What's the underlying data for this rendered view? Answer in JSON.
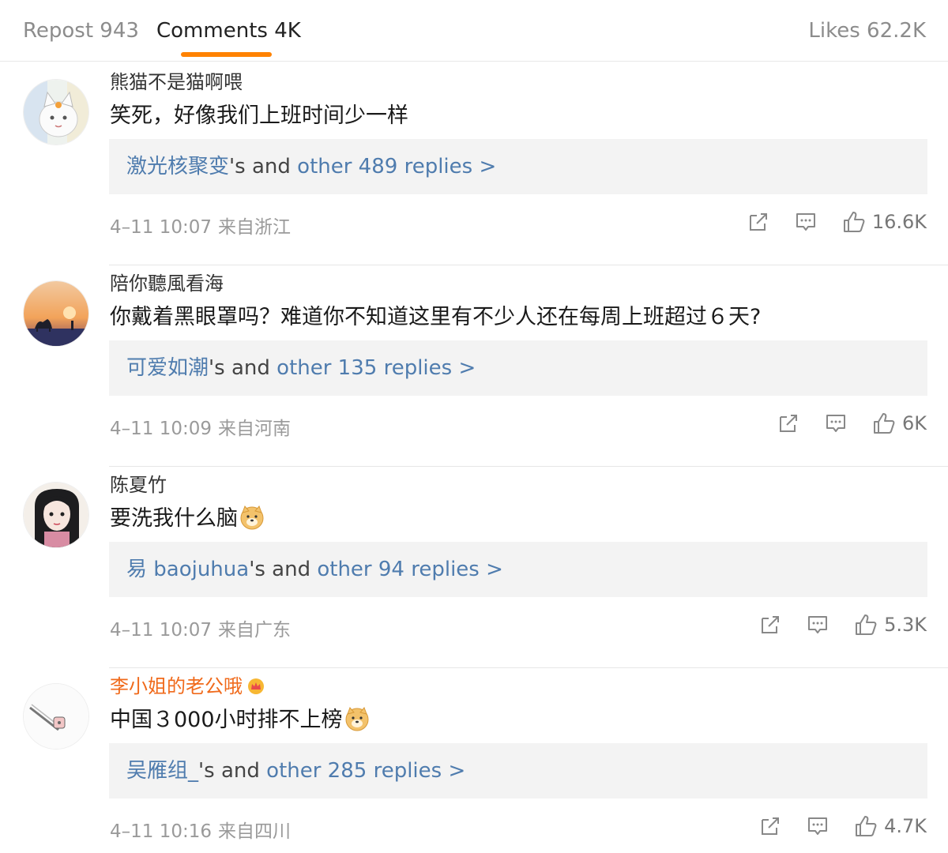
{
  "tabs": {
    "repost": "Repost 943",
    "comments": "Comments 4K",
    "likes": "Likes 62.2K",
    "active_color": "#ff8200"
  },
  "reply_mid_text": "'s and ",
  "comments": [
    {
      "username": "熊猫不是猫啊喂",
      "text": "笑死，好像我们上班时间少一样",
      "reply_user": "激光核聚变",
      "reply_count": "other 489 replies >",
      "date": "4–11 10:07",
      "location": "来自浙江",
      "likes": "16.6K"
    },
    {
      "username": "陪你聽風看海",
      "text": "你戴着黑眼罩吗？难道你不知道这里有不少人还在每周上班超过６天?",
      "reply_user": "可爱如潮",
      "reply_count": "other 135 replies >",
      "date": "4–11 10:09",
      "location": "来自河南",
      "likes": "6K"
    },
    {
      "username": "陈夏竹",
      "text": "要洗我什么脑",
      "emoji": "doge-emoji",
      "reply_user": "易 baojuhua",
      "reply_count": "other 94 replies >",
      "date": "4–11 10:07",
      "location": "来自广东",
      "likes": "5.3K"
    },
    {
      "username": "李小姐的老公哦",
      "username_color": "#f06a1b",
      "badge": "crown-badge-icon",
      "text": "中国３000小时排不上榜",
      "emoji": "doge-emoji",
      "reply_user": "吴雁组_",
      "reply_count": "other 285 replies >",
      "date": "4–11 10:16",
      "location": "来自四川",
      "likes": "4.7K"
    }
  ],
  "icons": {
    "repost": "share-out-icon",
    "comment": "comment-bubble-icon",
    "like": "thumbs-up-icon"
  }
}
